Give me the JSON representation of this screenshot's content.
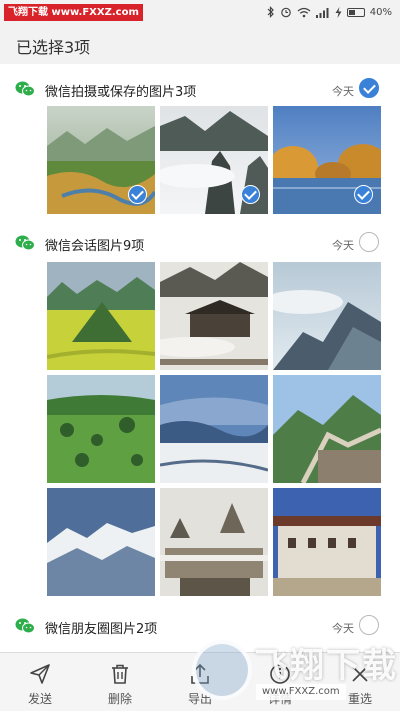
{
  "watermark": {
    "top_label": "飞翔下载 www.FXXZ.com",
    "bottom_text": "飞翔下载",
    "bottom_url": "www.FXXZ.com"
  },
  "status_bar": {
    "battery": "40%",
    "icons": [
      "bluetooth-icon",
      "alarm-icon",
      "wifi-icon",
      "signal-icon",
      "charging-icon",
      "battery-icon"
    ]
  },
  "header": {
    "title": "已选择3项"
  },
  "groups": [
    {
      "title": "微信拍摄或保存的图片3项",
      "date": "今天",
      "selected": true
    },
    {
      "title": "微信会话图片9项",
      "date": "今天",
      "selected": false
    },
    {
      "title": "微信朋友圈图片2项",
      "date": "今天",
      "selected": false
    }
  ],
  "toolbar": {
    "send": "发送",
    "delete": "删除",
    "export": "导出",
    "details": "详情",
    "reselect": "重选"
  },
  "colors": {
    "accent": "#3a82d8",
    "wechat_green": "#2dae4a",
    "watermark_red": "#d8232a"
  }
}
